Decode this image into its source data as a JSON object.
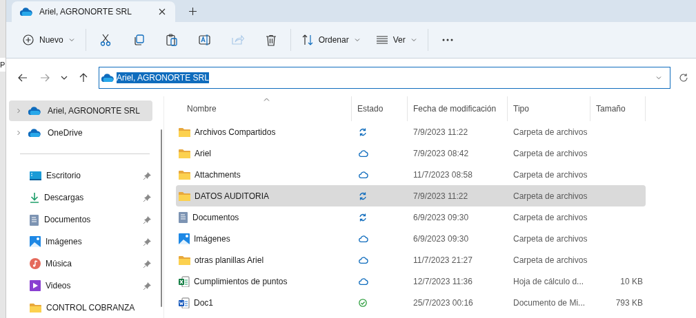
{
  "background_window_text": "P",
  "tab": {
    "title": "Ariel, AGRONORTE SRL"
  },
  "toolbar": {
    "items": [
      {
        "kind": "new",
        "label": "Nuevo",
        "disabled": false
      },
      {
        "kind": "cut",
        "disabled": false
      },
      {
        "kind": "copy",
        "disabled": false
      },
      {
        "kind": "paste",
        "disabled": false
      },
      {
        "kind": "rename",
        "disabled": false
      },
      {
        "kind": "share",
        "disabled": true
      },
      {
        "kind": "delete",
        "disabled": false
      },
      {
        "kind": "sort",
        "label": "Ordenar",
        "disabled": false
      },
      {
        "kind": "view",
        "label": "Ver",
        "disabled": false
      },
      {
        "kind": "more",
        "disabled": false
      }
    ]
  },
  "address": {
    "value": "Ariel, AGRONORTE SRL"
  },
  "sidebar": {
    "roots": [
      {
        "label": "Ariel, AGRONORTE SRL",
        "selected": true,
        "expanded": false
      },
      {
        "label": "OneDrive",
        "selected": false,
        "expanded": false
      }
    ],
    "quick_access": [
      {
        "label": "Escritorio",
        "kind": "desktop",
        "pinned": true
      },
      {
        "label": "Descargas",
        "kind": "download",
        "pinned": true
      },
      {
        "label": "Documentos",
        "kind": "documents",
        "pinned": true
      },
      {
        "label": "Imágenes",
        "kind": "images",
        "pinned": true
      },
      {
        "label": "Música",
        "kind": "music",
        "pinned": true
      },
      {
        "label": "Videos",
        "kind": "videos",
        "pinned": true
      },
      {
        "label": "CONTROL COBRANZA",
        "kind": "folder",
        "pinned": false
      }
    ]
  },
  "table": {
    "columns": [
      {
        "label": "Nombre",
        "sorted": true
      },
      {
        "label": "Estado",
        "sorted": false
      },
      {
        "label": "Fecha de modificación",
        "sorted": false
      },
      {
        "label": "Tipo",
        "sorted": false
      },
      {
        "label": "Tamaño",
        "sorted": false
      }
    ],
    "rows": [
      {
        "name": "Archivos Compartidos",
        "kind": "folder",
        "sync_state": {
          "kind": "syncing"
        },
        "modified": "7/9/2023 11:22",
        "type": "Carpeta de archivos",
        "selected": false
      },
      {
        "name": "Ariel",
        "kind": "folder",
        "sync_state": {
          "kind": "online"
        },
        "modified": "7/9/2023 08:42",
        "type": "Carpeta de archivos",
        "selected": false
      },
      {
        "name": "Attachments",
        "kind": "folder",
        "sync_state": {
          "kind": "online"
        },
        "modified": "11/7/2023 08:58",
        "type": "Carpeta de archivos",
        "selected": false
      },
      {
        "name": "DATOS AUDITORIA",
        "kind": "folder",
        "sync_state": {
          "kind": "syncing"
        },
        "modified": "7/9/2023 11:22",
        "type": "Carpeta de archivos",
        "selected": true
      },
      {
        "name": "Documentos",
        "kind": "documents",
        "sync_state": {
          "kind": "syncing"
        },
        "modified": "6/9/2023 09:30",
        "type": "Carpeta de archivos",
        "selected": false
      },
      {
        "name": "Imágenes",
        "kind": "images",
        "sync_state": {
          "kind": "online"
        },
        "modified": "6/9/2023 09:30",
        "type": "Carpeta de archivos",
        "selected": false
      },
      {
        "name": "otras planillas Ariel",
        "kind": "folder",
        "sync_state": {
          "kind": "online"
        },
        "modified": "11/7/2023 21:27",
        "type": "Carpeta de archivos",
        "selected": false
      },
      {
        "name": "Cumplimientos de puntos",
        "kind": "excel",
        "sync_state": {
          "kind": "online"
        },
        "modified": "12/7/2023 11:36",
        "type": "Hoja de cálculo d...",
        "size": "10 KB",
        "selected": false
      },
      {
        "name": "Doc1",
        "kind": "word",
        "sync_state": {
          "kind": "local"
        },
        "modified": "25/7/2023 00:16",
        "type": "Documento de Mi...",
        "size": "793 KB",
        "selected": false
      }
    ]
  }
}
